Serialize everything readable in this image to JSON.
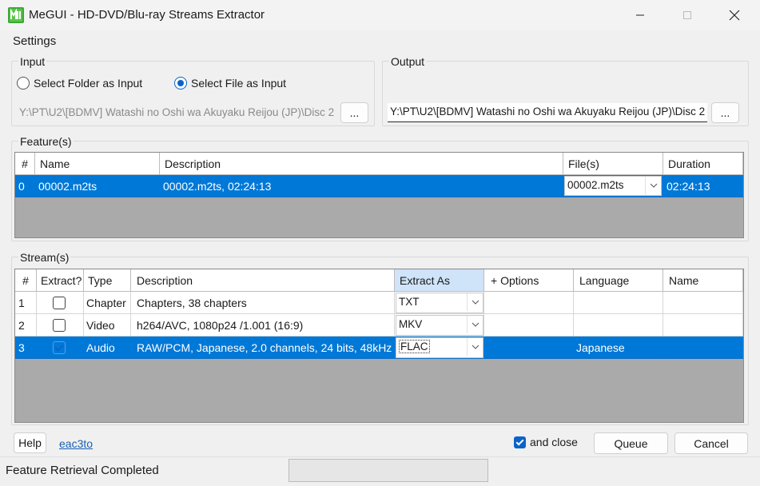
{
  "window": {
    "title": "MeGUI - HD-DVD/Blu-ray Streams Extractor",
    "icon": "megui-app-icon"
  },
  "menu": {
    "settings": "Settings"
  },
  "input": {
    "group_label": "Input",
    "radio_folder": "Select Folder as Input",
    "radio_file": "Select File as Input",
    "selected": "file",
    "path": "Y:\\PT\\U2\\[BDMV] Watashi no Oshi wa Akuyaku Reijou (JP)\\Disc 2",
    "browse": "..."
  },
  "output": {
    "group_label": "Output",
    "path": "Y:\\PT\\U2\\[BDMV] Watashi no Oshi wa Akuyaku Reijou (JP)\\Disc 2",
    "browse": "..."
  },
  "features": {
    "group_label": "Feature(s)",
    "headers": [
      "#",
      "Name",
      "Description",
      "File(s)",
      "Duration"
    ],
    "rows": [
      {
        "num": "0",
        "name": "00002.m2ts",
        "description": "00002.m2ts, 02:24:13",
        "files": "00002.m2ts",
        "duration": "02:24:13",
        "selected": true
      }
    ]
  },
  "streams": {
    "group_label": "Stream(s)",
    "headers": [
      "#",
      "Extract?",
      "Type",
      "Description",
      "Extract As",
      "+ Options",
      "Language",
      "Name"
    ],
    "rows": [
      {
        "num": "1",
        "extract": false,
        "type": "Chapter",
        "description": "Chapters, 38 chapters",
        "extract_as": "TXT",
        "options": "",
        "language": "",
        "name": "",
        "selected": false
      },
      {
        "num": "2",
        "extract": false,
        "type": "Video",
        "description": "h264/AVC, 1080p24 /1.001 (16:9)",
        "extract_as": "MKV",
        "options": "",
        "language": "",
        "name": "",
        "selected": false
      },
      {
        "num": "3",
        "extract": true,
        "type": "Audio",
        "description": "RAW/PCM, Japanese, 2.0 channels, 24 bits, 48kHz",
        "extract_as": "FLAC",
        "options": "",
        "language": "Japanese",
        "name": "",
        "selected": true
      }
    ]
  },
  "bottom": {
    "help": "Help",
    "link": "eac3to",
    "and_close": "and close",
    "and_close_checked": true,
    "queue": "Queue",
    "cancel": "Cancel"
  },
  "status": {
    "text": "Feature Retrieval Completed",
    "progress": 0
  },
  "colors": {
    "selection": "#0078d7",
    "accent": "#0a64c8",
    "grid_bg": "#aaaaaa",
    "header_accent": "#cfe3f9"
  }
}
